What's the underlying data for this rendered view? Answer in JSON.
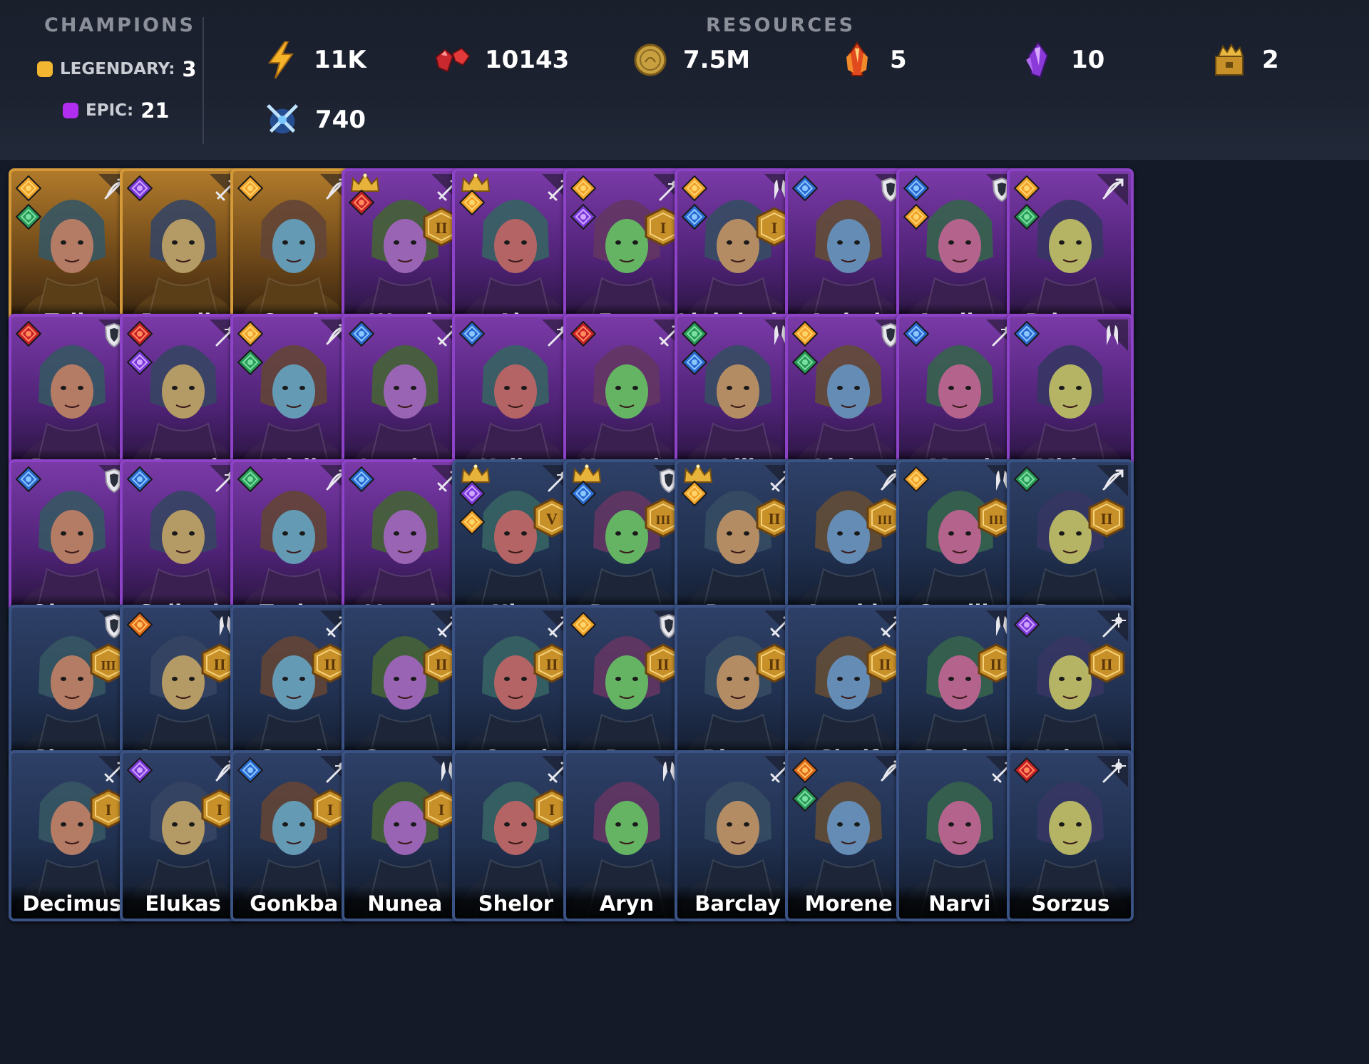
{
  "header": {
    "champions_title": "CHAMPIONS",
    "resources_title": "RESOURCES",
    "legendary_label": "LEGENDARY:",
    "legendary_count": "3",
    "epic_label": "EPIC:",
    "epic_count": "21",
    "resources": [
      {
        "icon": "energy-bolt-icon",
        "value": "11K"
      },
      {
        "icon": "rubies-icon",
        "value": "10143"
      },
      {
        "icon": "gold-coin-icon",
        "value": "7.5M"
      },
      {
        "icon": "fire-crystal-icon",
        "value": "5"
      },
      {
        "icon": "purple-crystal-icon",
        "value": "10"
      },
      {
        "icon": "gold-chest-icon",
        "value": "2"
      },
      {
        "icon": "crossed-swords-icon",
        "value": "740"
      }
    ]
  },
  "colors": {
    "legendary": "#f2b630",
    "epic": "#b12ef0",
    "rare": "#3a5284"
  },
  "champions": [
    {
      "name": "Talin",
      "rarity": "legendary",
      "class": "archer",
      "affinities": [
        "sun",
        "forest"
      ],
      "crown": false,
      "ascension": ""
    },
    {
      "name": "Rosalia",
      "rarity": "legendary",
      "class": "warrior",
      "affinities": [
        "arcane"
      ],
      "crown": false,
      "ascension": ""
    },
    {
      "name": "Crach",
      "rarity": "legendary",
      "class": "archer",
      "affinities": [
        "sun"
      ],
      "crown": false,
      "ascension": ""
    },
    {
      "name": "Wrath",
      "rarity": "epic",
      "class": "warrior",
      "affinities": [
        "fire"
      ],
      "crown": true,
      "ascension": "II"
    },
    {
      "name": "Ain",
      "rarity": "epic",
      "class": "warrior",
      "affinities": [
        "sun"
      ],
      "crown": true,
      "ascension": ""
    },
    {
      "name": "Eona",
      "rarity": "epic",
      "class": "mage",
      "affinities": [
        "sun",
        "arcane"
      ],
      "crown": false,
      "ascension": "I"
    },
    {
      "name": "Lightlocke",
      "rarity": "epic",
      "class": "support",
      "affinities": [
        "sun",
        "tide"
      ],
      "crown": false,
      "ascension": "I"
    },
    {
      "name": "Ardeth",
      "rarity": "epic",
      "class": "tank",
      "affinities": [
        "tide"
      ],
      "crown": false,
      "ascension": ""
    },
    {
      "name": "Aveline",
      "rarity": "epic",
      "class": "tank",
      "affinities": [
        "tide",
        "sun"
      ],
      "crown": false,
      "ascension": ""
    },
    {
      "name": "Brienne",
      "rarity": "epic",
      "class": "archer",
      "affinities": [
        "sun",
        "forest"
      ],
      "crown": false,
      "ascension": ""
    },
    {
      "name": "Drayga",
      "rarity": "epic",
      "class": "tank",
      "affinities": [
        "fire"
      ],
      "crown": false,
      "ascension": ""
    },
    {
      "name": "Greed",
      "rarity": "epic",
      "class": "mage",
      "affinities": [
        "fire",
        "arcane"
      ],
      "crown": false,
      "ascension": ""
    },
    {
      "name": "Idril",
      "rarity": "epic",
      "class": "archer",
      "affinities": [
        "sun",
        "forest"
      ],
      "crown": false,
      "ascension": ""
    },
    {
      "name": "Janqhar",
      "rarity": "epic",
      "class": "warrior",
      "affinities": [
        "tide"
      ],
      "crown": false,
      "ascension": ""
    },
    {
      "name": "Kalina",
      "rarity": "epic",
      "class": "mage",
      "affinities": [
        "tide"
      ],
      "crown": false,
      "ascension": ""
    },
    {
      "name": "Komodo",
      "rarity": "epic",
      "class": "warrior",
      "affinities": [
        "fire"
      ],
      "crown": false,
      "ascension": ""
    },
    {
      "name": "Lili",
      "rarity": "epic",
      "class": "support",
      "affinities": [
        "forest",
        "tide"
      ],
      "crown": false,
      "ascension": ""
    },
    {
      "name": "Livian",
      "rarity": "epic",
      "class": "tank",
      "affinities": [
        "sun",
        "forest"
      ],
      "crown": false,
      "ascension": ""
    },
    {
      "name": "Marri",
      "rarity": "epic",
      "class": "mage",
      "affinities": [
        "tide"
      ],
      "crown": false,
      "ascension": ""
    },
    {
      "name": "Midan",
      "rarity": "epic",
      "class": "support",
      "affinities": [
        "tide"
      ],
      "crown": false,
      "ascension": ""
    },
    {
      "name": "Olague",
      "rarity": "epic",
      "class": "tank",
      "affinities": [
        "tide"
      ],
      "crown": false,
      "ascension": ""
    },
    {
      "name": "Selkath",
      "rarity": "epic",
      "class": "mage",
      "affinities": [
        "tide"
      ],
      "crown": false,
      "ascension": ""
    },
    {
      "name": "Tazira",
      "rarity": "epic",
      "class": "archer",
      "affinities": [
        "forest"
      ],
      "crown": false,
      "ascension": ""
    },
    {
      "name": "Voroth",
      "rarity": "epic",
      "class": "warrior",
      "affinities": [
        "tide"
      ],
      "crown": false,
      "ascension": ""
    },
    {
      "name": "Niro",
      "rarity": "rare",
      "class": "mage",
      "affinities": [
        "arcane",
        "sun"
      ],
      "crown": true,
      "ascension": "V"
    },
    {
      "name": "Dagna",
      "rarity": "rare",
      "class": "tank",
      "affinities": [
        "tide"
      ],
      "crown": true,
      "ascension": "III"
    },
    {
      "name": "Borut",
      "rarity": "rare",
      "class": "warrior",
      "affinities": [
        "sun"
      ],
      "crown": true,
      "ascension": "II"
    },
    {
      "name": "Amahle",
      "rarity": "rare",
      "class": "archer",
      "affinities": [],
      "crown": false,
      "ascension": "III"
    },
    {
      "name": "Camille",
      "rarity": "rare",
      "class": "support",
      "affinities": [
        "sun"
      ],
      "crown": false,
      "ascension": "III"
    },
    {
      "name": "Drogo",
      "rarity": "rare",
      "class": "archer",
      "affinities": [
        "forest"
      ],
      "crown": false,
      "ascension": "II"
    },
    {
      "name": "Ghorza",
      "rarity": "rare",
      "class": "tank",
      "affinities": [],
      "crown": false,
      "ascension": "III"
    },
    {
      "name": "Autumn",
      "rarity": "rare",
      "class": "support",
      "affinities": [
        "ember"
      ],
      "crown": false,
      "ascension": "II"
    },
    {
      "name": "Gnash",
      "rarity": "rare",
      "class": "warrior",
      "affinities": [],
      "crown": false,
      "ascension": "II"
    },
    {
      "name": "Gogran",
      "rarity": "rare",
      "class": "warrior",
      "affinities": [],
      "crown": false,
      "ascension": "II"
    },
    {
      "name": "Ogrul",
      "rarity": "rare",
      "class": "warrior",
      "affinities": [],
      "crown": false,
      "ascension": "II"
    },
    {
      "name": "Rex",
      "rarity": "rare",
      "class": "tank",
      "affinities": [
        "sun"
      ],
      "crown": false,
      "ascension": "II"
    },
    {
      "name": "Rhutu",
      "rarity": "rare",
      "class": "warrior",
      "affinities": [],
      "crown": false,
      "ascension": "II"
    },
    {
      "name": "Skulf",
      "rarity": "rare",
      "class": "warrior",
      "affinities": [],
      "crown": false,
      "ascension": "II"
    },
    {
      "name": "Spring",
      "rarity": "rare",
      "class": "support",
      "affinities": [],
      "crown": false,
      "ascension": "II"
    },
    {
      "name": "Voltus",
      "rarity": "rare",
      "class": "mage",
      "affinities": [
        "arcane"
      ],
      "crown": false,
      "ascension": "II"
    },
    {
      "name": "Decimus",
      "rarity": "rare",
      "class": "warrior",
      "affinities": [],
      "crown": false,
      "ascension": "I"
    },
    {
      "name": "Elukas",
      "rarity": "rare",
      "class": "archer",
      "affinities": [
        "arcane"
      ],
      "crown": false,
      "ascension": "I"
    },
    {
      "name": "Gonkba",
      "rarity": "rare",
      "class": "mage",
      "affinities": [
        "tide"
      ],
      "crown": false,
      "ascension": "I"
    },
    {
      "name": "Nunea",
      "rarity": "rare",
      "class": "support",
      "affinities": [],
      "crown": false,
      "ascension": "I"
    },
    {
      "name": "Shelor",
      "rarity": "rare",
      "class": "warrior",
      "affinities": [],
      "crown": false,
      "ascension": "I"
    },
    {
      "name": "Aryn",
      "rarity": "rare",
      "class": "support",
      "affinities": [],
      "crown": false,
      "ascension": ""
    },
    {
      "name": "Barclay",
      "rarity": "rare",
      "class": "warrior",
      "affinities": [],
      "crown": false,
      "ascension": ""
    },
    {
      "name": "Morene",
      "rarity": "rare",
      "class": "archer",
      "affinities": [
        "ember",
        "forest"
      ],
      "crown": false,
      "ascension": ""
    },
    {
      "name": "Narvi",
      "rarity": "rare",
      "class": "warrior",
      "affinities": [],
      "crown": false,
      "ascension": ""
    },
    {
      "name": "Sorzus",
      "rarity": "rare",
      "class": "mage",
      "affinities": [
        "fire"
      ],
      "crown": false,
      "ascension": ""
    }
  ]
}
